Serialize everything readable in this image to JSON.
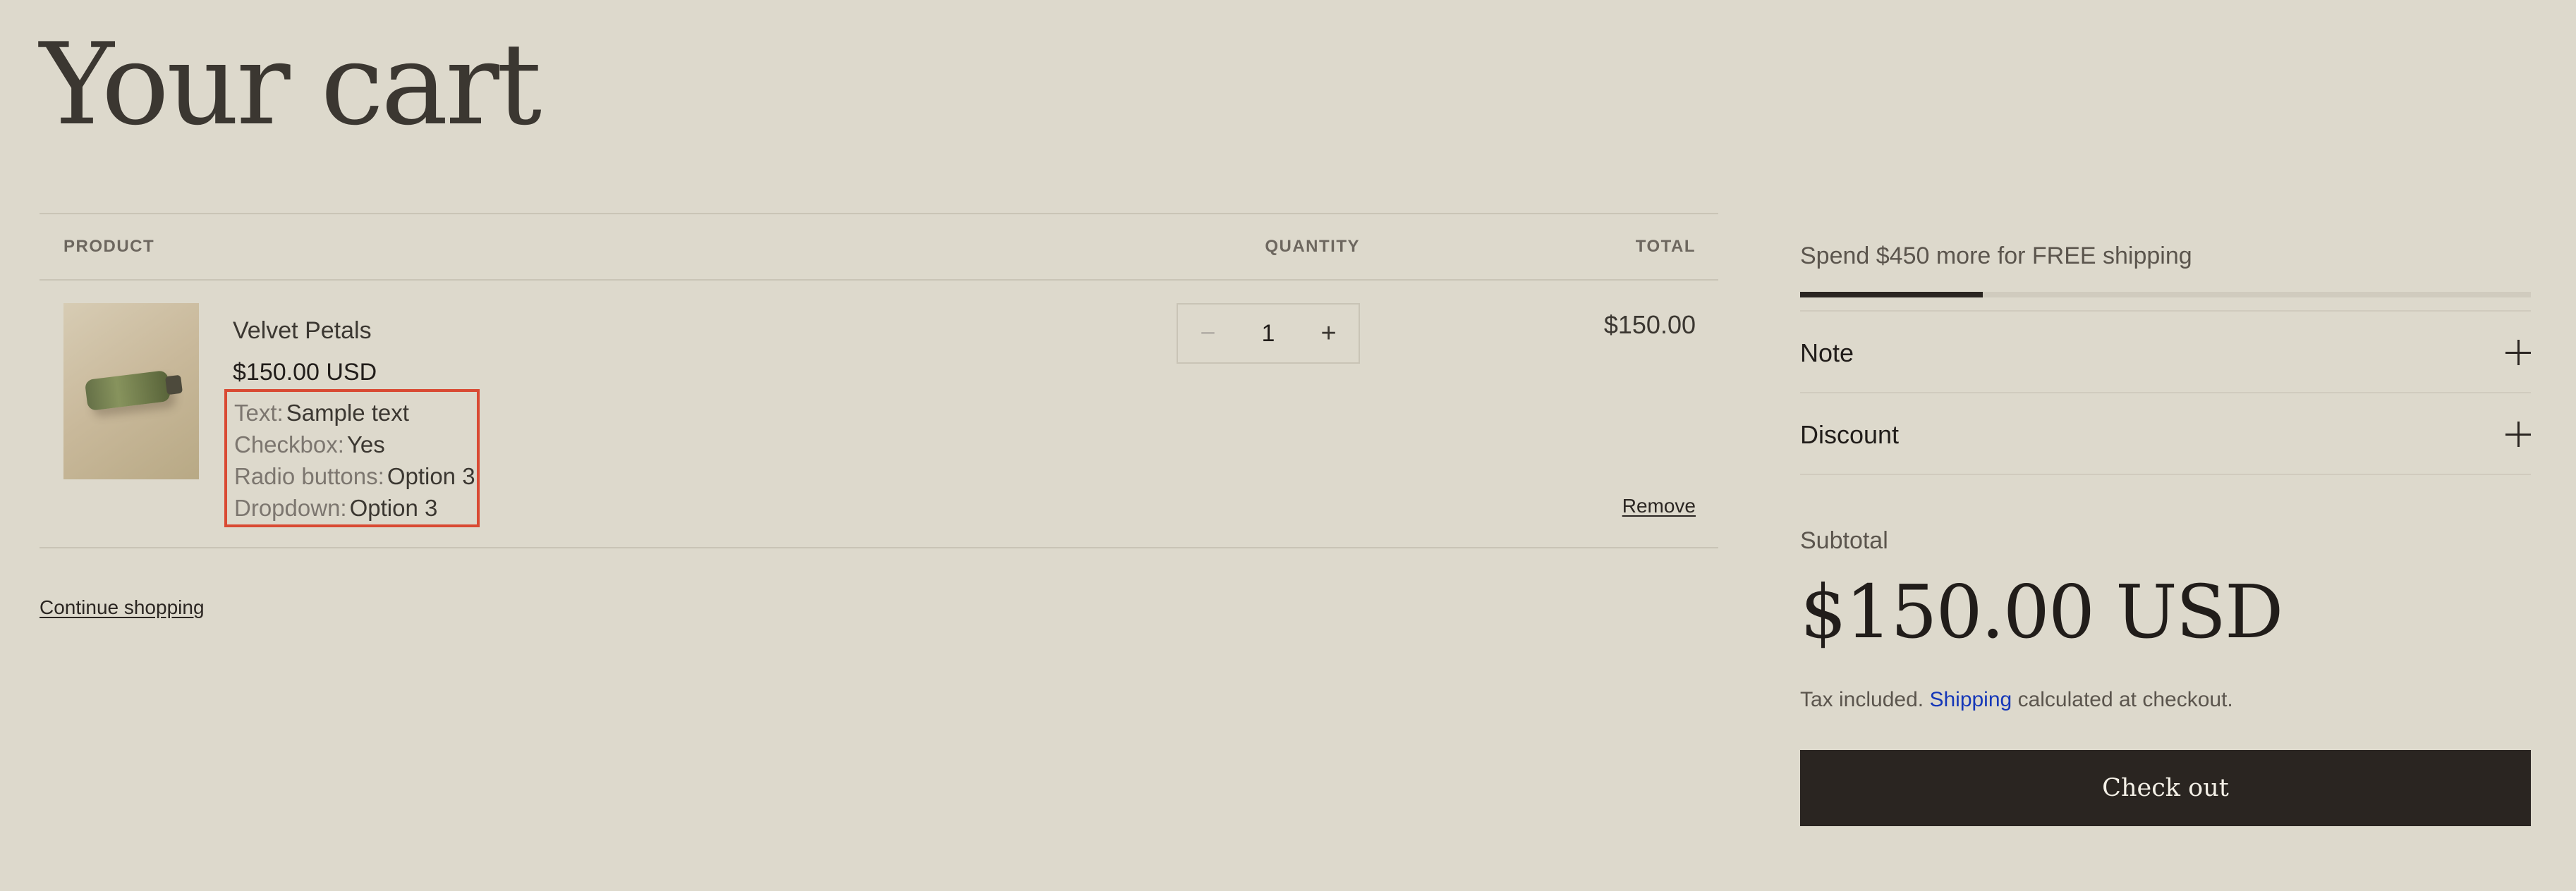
{
  "page": {
    "title": "Your cart"
  },
  "table": {
    "headers": {
      "product": "PRODUCT",
      "quantity": "QUANTITY",
      "total": "TOTAL"
    },
    "items": [
      {
        "name": "Velvet Petals",
        "price": "$150.00 USD",
        "properties": [
          {
            "name": "Text:",
            "value": "Sample text"
          },
          {
            "name": "Checkbox:",
            "value": "Yes"
          },
          {
            "name": "Radio buttons:",
            "value": "Option 3"
          },
          {
            "name": "Dropdown:",
            "value": "Option 3"
          }
        ],
        "quantity": "1",
        "quantity_controls": {
          "decrease": "−",
          "increase": "+"
        },
        "line_total": "$150.00",
        "remove_label": "Remove",
        "image_icon": "perfume-bottle-image"
      }
    ]
  },
  "links": {
    "continue_shopping": "Continue shopping"
  },
  "summary": {
    "shipping_message": "Spend $450 more for FREE shipping",
    "shipping_progress": 0.25,
    "accordions": [
      {
        "label": "Note",
        "icon": "plus-icon"
      },
      {
        "label": "Discount",
        "icon": "plus-icon"
      }
    ],
    "subtotal_label": "Subtotal",
    "subtotal_value": "$150.00 USD",
    "tax_note_prefix": "Tax included.",
    "shipping_link": "Shipping",
    "tax_note_suffix": "calculated at checkout.",
    "checkout_label": "Check out"
  },
  "colors": {
    "background": "#ddd9cc",
    "text": "#2b2622",
    "button": "#2a2521",
    "highlight_border": "#d94a33",
    "link": "#1638b8"
  }
}
